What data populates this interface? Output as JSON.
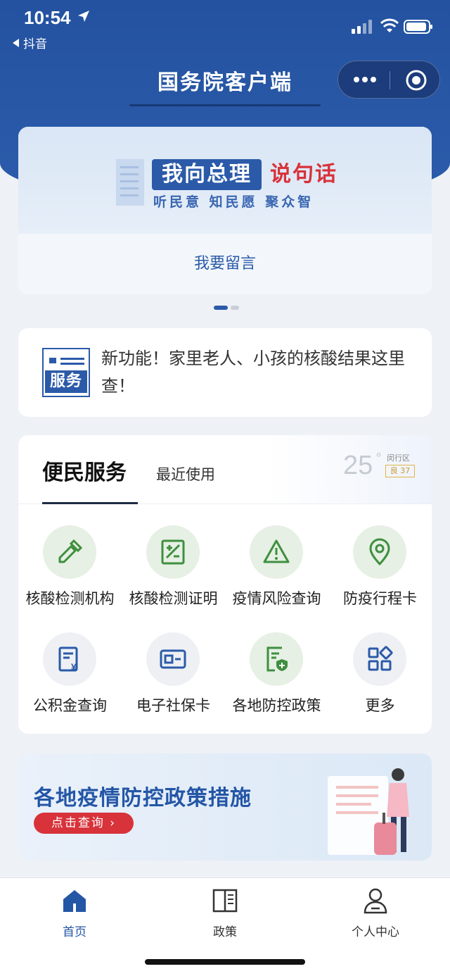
{
  "status_bar": {
    "time": "10:54",
    "back_app": "抖音"
  },
  "nav": {
    "title": "国务院客户端"
  },
  "banner": {
    "slogan_blue": "我向总理",
    "slogan_red": "说句话",
    "slogan_sub": "听民意  知民愿  聚众智",
    "action": "我要留言",
    "pages": 2,
    "current_page": 1
  },
  "notice": {
    "icon_label": "服务",
    "text": "新功能！家里老人、小孩的核酸结果这里查！"
  },
  "services": {
    "tab_active": "便民服务",
    "tab_recent": "最近使用",
    "weather": {
      "temperature": "25",
      "degree": "°",
      "district": "闵行区",
      "aqi": "良 37"
    },
    "items": [
      {
        "label": "核酸检测机构",
        "icon": "dropper-icon"
      },
      {
        "label": "核酸检测证明",
        "icon": "certificate-icon"
      },
      {
        "label": "疫情风险查询",
        "icon": "warning-icon"
      },
      {
        "label": "防疫行程卡",
        "icon": "location-pin-icon"
      },
      {
        "label": "公积金查询",
        "icon": "fund-document-icon"
      },
      {
        "label": "电子社保卡",
        "icon": "id-card-icon"
      },
      {
        "label": "各地防控政策",
        "icon": "shield-document-icon"
      },
      {
        "label": "更多",
        "icon": "grid-more-icon"
      }
    ]
  },
  "promo": {
    "title": "各地疫情防控政策措施",
    "button": "点击查询 ›"
  },
  "tabbar": {
    "items": [
      {
        "label": "首页",
        "icon": "home-icon",
        "active": true
      },
      {
        "label": "政策",
        "icon": "book-icon",
        "active": false
      },
      {
        "label": "个人中心",
        "icon": "person-icon",
        "active": false
      }
    ]
  },
  "colors": {
    "brand_blue": "#2b5aa8",
    "accent_red": "#d8323a",
    "icon_green": "#4a9a4a"
  }
}
